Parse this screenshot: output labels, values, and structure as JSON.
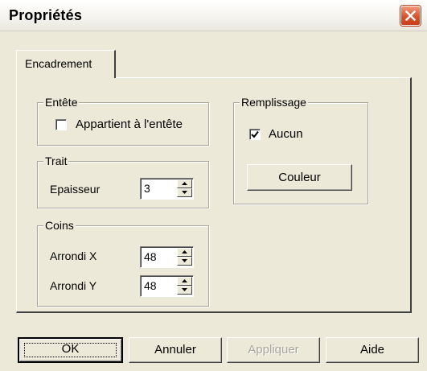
{
  "window": {
    "title": "Propriétés",
    "close_icon": "close-icon"
  },
  "tabs": [
    {
      "label": "Encadrement",
      "selected": true
    }
  ],
  "groups": {
    "entete": {
      "label": "Entête",
      "checkbox_label": "Appartient à l'entête",
      "checked": false
    },
    "trait": {
      "label": "Trait",
      "epaisseur_label": "Epaisseur",
      "epaisseur_value": "3"
    },
    "coins": {
      "label": "Coins",
      "arrondi_x_label": "Arrondi X",
      "arrondi_x_value": "48",
      "arrondi_y_label": "Arrondi Y",
      "arrondi_y_value": "48"
    },
    "remplissage": {
      "label": "Remplissage",
      "aucun_label": "Aucun",
      "aucun_checked": true,
      "couleur_button": "Couleur"
    }
  },
  "buttons": {
    "ok": "OK",
    "annuler": "Annuler",
    "appliquer": "Appliquer",
    "aide": "Aide"
  },
  "colors": {
    "dialog_background": "#ECE9D8",
    "close_button": "#D8532B",
    "disabled_text": "#A7A69D"
  }
}
